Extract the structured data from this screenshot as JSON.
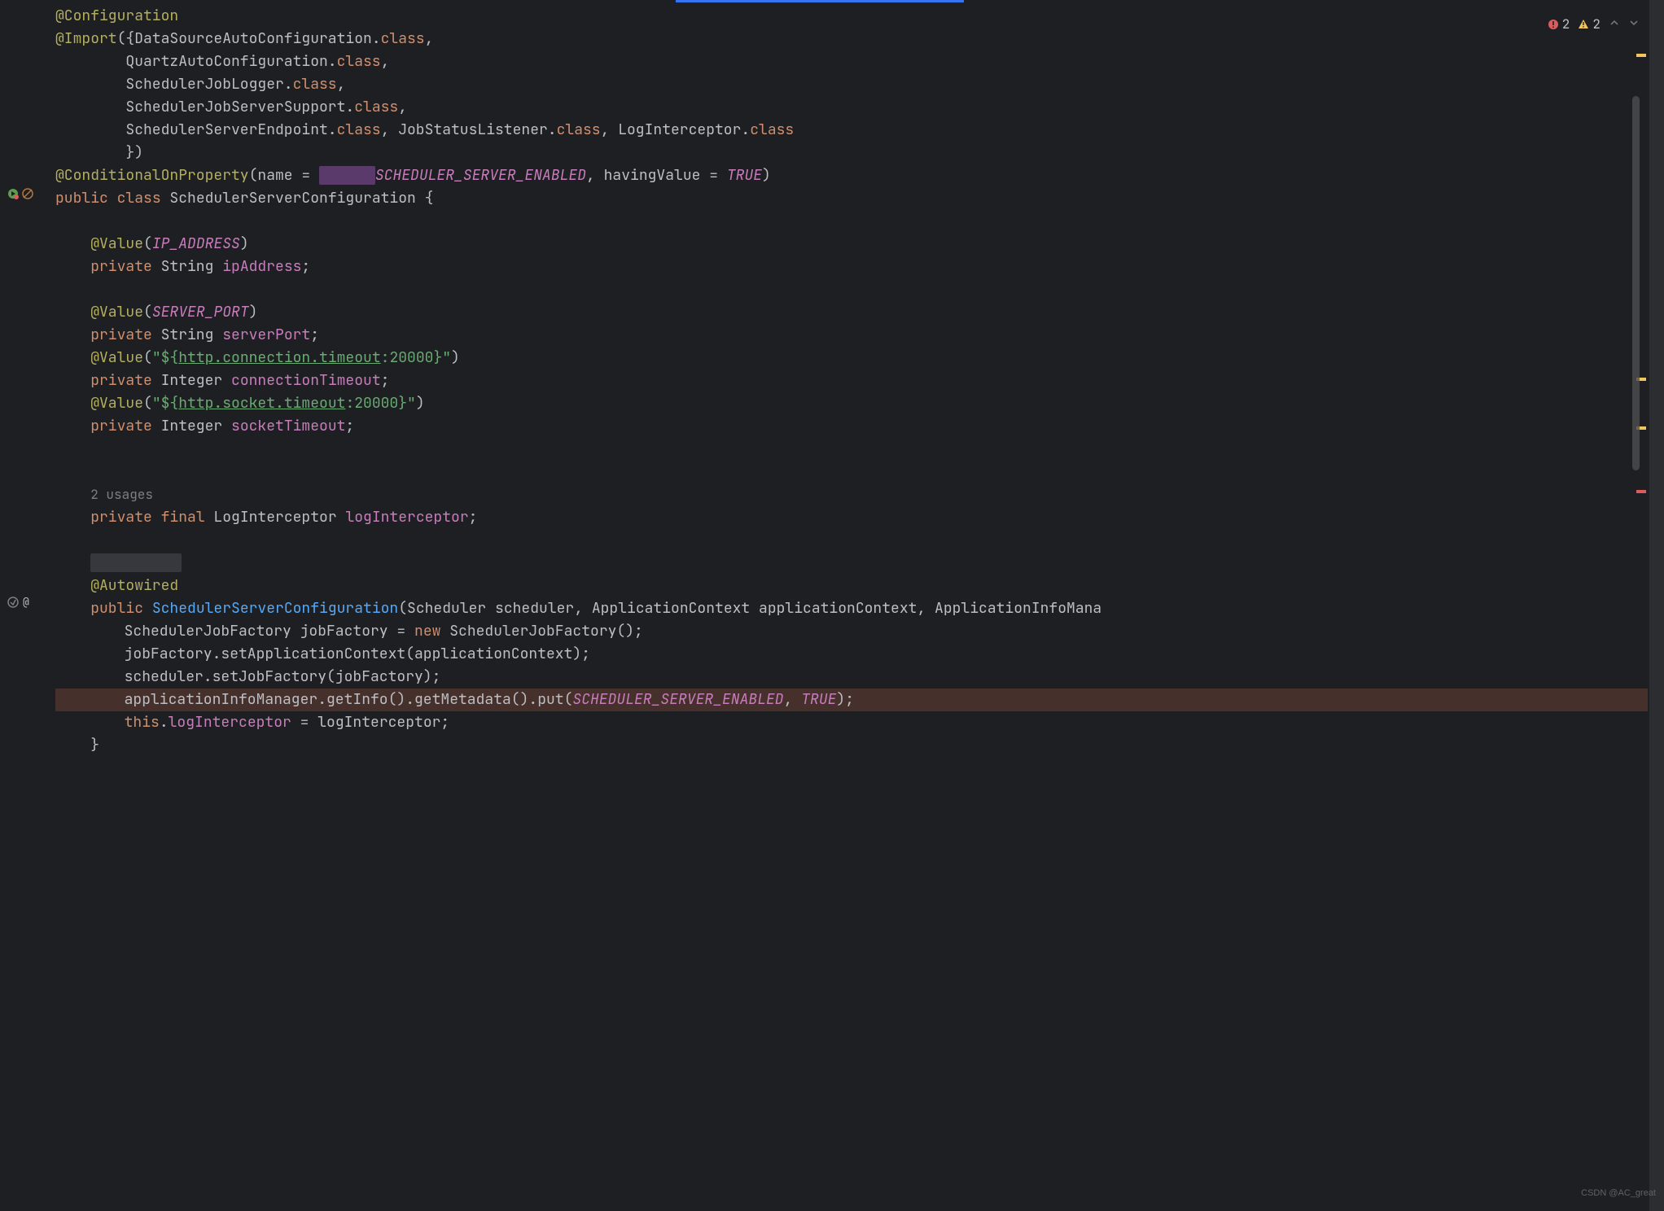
{
  "inspections": {
    "errors": "2",
    "warnings": "2"
  },
  "watermark": "CSDN @AC_great",
  "gutter_icons": {
    "class_line": [
      "run-icon",
      "nav-icon"
    ],
    "ctor_line": [
      "impl-icon",
      "anno-icon"
    ]
  },
  "code": {
    "l1_anno": "@Configuration",
    "l2_anno": "@Import",
    "l2_rest_a": "({DataSourceAutoConfiguration.",
    "l2_class": "class",
    "l2_rest_b": ",",
    "l3_a": "QuartzAutoConfiguration.",
    "l3_class": "class",
    "l3_b": ",",
    "l4_a": "SchedulerJobLogger.",
    "l4_class": "class",
    "l4_b": ",",
    "l5_a": "SchedulerJobServerSupport.",
    "l5_class": "class",
    "l5_b": ",",
    "l6_a": "SchedulerServerEndpoint.",
    "l6_class": "class",
    "l6_b": ", JobStatusListener.",
    "l6_class2": "class",
    "l6_c": ", LogInterceptor.",
    "l6_class3": "class",
    "l7": "})",
    "l8_anno": "@ConditionalOnProperty",
    "l8_a": "(name = ",
    "l8_red": "xxxxxx",
    "l8_const": "SCHEDULER_SERVER_ENABLED",
    "l8_b": ", havingValue = ",
    "l8_true": "TRUE",
    "l8_c": ")",
    "l9_pub": "public",
    "l9_class": "class",
    "l9_name": " SchedulerServerConfiguration {",
    "l11_anno": "@Value",
    "l11_a": "(",
    "l11_const": "IP_ADDRESS",
    "l11_b": ")",
    "l12_priv": "private",
    "l12_type": " String ",
    "l12_field": "ipAddress",
    "l12_semi": ";",
    "l14_anno": "@Value",
    "l14_a": "(",
    "l14_const": "SERVER_PORT",
    "l14_b": ")",
    "l15_priv": "private",
    "l15_type": " String ",
    "l15_field": "serverPort",
    "l15_semi": ";",
    "l16_anno": "@Value",
    "l16_a": "(",
    "l16_str_a": "\"${",
    "l16_link": "http.connection.timeout",
    "l16_str_b": ":20000}\"",
    "l16_b": ")",
    "l17_priv": "private",
    "l17_type": " Integer ",
    "l17_field": "connectionTimeout",
    "l17_semi": ";",
    "l18_anno": "@Value",
    "l18_a": "(",
    "l18_str_a": "\"${",
    "l18_link": "http.socket.timeout",
    "l18_str_b": ":20000}\"",
    "l18_b": ")",
    "l19_priv": "private",
    "l19_type": " Integer ",
    "l19_field": "socketTimeout",
    "l19_semi": ";",
    "l22_usages": "2 usages",
    "l23_priv": "private",
    "l23_final": "final",
    "l23_type": " LogInterceptor ",
    "l23_field": "logInterceptor",
    "l23_semi": ";",
    "l25_red": "xxxx  xxxx",
    "l26_anno": "@Autowired",
    "l27_pub": "public",
    "l27_ctor": "SchedulerServerConfiguration",
    "l27_params": "(Scheduler scheduler, ApplicationContext applicationContext, ApplicationInfoMana",
    "l28_a": "SchedulerJobFactory jobFactory = ",
    "l28_new": "new",
    "l28_b": " SchedulerJobFactory();",
    "l29": "jobFactory.setApplicationContext(applicationContext);",
    "l30": "scheduler.setJobFactory(jobFactory);",
    "l31_a": "applicationInfoManager.getInfo().getMetadata().put(",
    "l31_const": "SCHEDULER_SERVER_ENABLED",
    "l31_b": ", ",
    "l31_true": "TRUE",
    "l31_c": ");",
    "l32_this": "this",
    "l32_a": ".",
    "l32_field": "logInterceptor",
    "l32_b": " = logInterceptor;",
    "l33": "}"
  }
}
